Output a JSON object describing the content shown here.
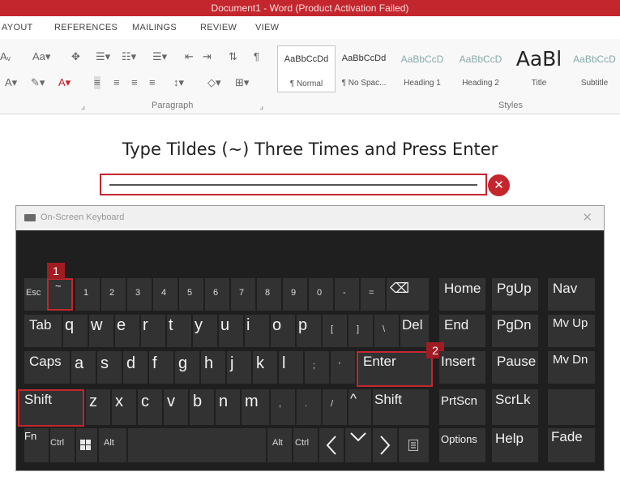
{
  "window": {
    "title": "Document1 - Word (Product Activation Failed)"
  },
  "tabs": [
    "AYOUT",
    "REFERENCES",
    "MAILINGS",
    "REVIEW",
    "VIEW"
  ],
  "ribbon": {
    "groups": {
      "paragraph": "Paragraph",
      "styles": "Styles"
    },
    "styles": [
      {
        "sample": "AaBbCcDd",
        "name": "¶ Normal",
        "selected": true
      },
      {
        "sample": "AaBbCcDd",
        "name": "¶ No Spac...",
        "selected": false
      },
      {
        "sample": "AaBbCcD",
        "name": "Heading 1",
        "selected": false
      },
      {
        "sample": "AaBbCcD",
        "name": "Heading 2",
        "selected": false
      },
      {
        "sample": "AaBl",
        "name": "Title",
        "selected": false
      },
      {
        "sample": "AaBbCcD",
        "name": "Subtitle",
        "selected": false
      }
    ]
  },
  "document": {
    "heading": "Type Tildes (~) Three Times and Press Enter",
    "typed_line": "~~~",
    "close_badge": "✕"
  },
  "osk": {
    "title": "On-Screen Keyboard",
    "close": "✕",
    "badges": {
      "one": "1",
      "two": "2"
    },
    "row1": {
      "esc": "Esc",
      "tilde": "~",
      "digits": [
        "1",
        "2",
        "3",
        "4",
        "5",
        "6",
        "7",
        "8",
        "9",
        "0",
        "-",
        "="
      ],
      "backspace": "⌫",
      "home": "Home",
      "pgup": "PgUp",
      "nav": "Nav"
    },
    "row2": {
      "tab": "Tab",
      "letters": [
        "q",
        "w",
        "e",
        "r",
        "t",
        "y",
        "u",
        "i",
        "o",
        "p",
        "[",
        "]",
        "\\"
      ],
      "del": "Del",
      "end": "End",
      "pgdn": "PgDn",
      "mvup": "Mv Up"
    },
    "row3": {
      "caps": "Caps",
      "letters": [
        "a",
        "s",
        "d",
        "f",
        "g",
        "h",
        "j",
        "k",
        "l",
        ";",
        "'"
      ],
      "enter": "Enter",
      "insert": "Insert",
      "pause": "Pause",
      "mvdn": "Mv Dn"
    },
    "row4": {
      "shift": "Shift",
      "letters": [
        "z",
        "x",
        "c",
        "v",
        "b",
        "n",
        "m",
        ",",
        ".",
        "/"
      ],
      "up": "^",
      "rshift": "Shift",
      "prtscn": "PrtScn",
      "scrlk": "ScrLk"
    },
    "row5": {
      "fn": "Fn",
      "ctrl": "Ctrl",
      "alt": "Alt",
      "ralt": "Alt",
      "rctrl": "Ctrl",
      "options": "Options",
      "help": "Help",
      "fade": "Fade"
    }
  }
}
